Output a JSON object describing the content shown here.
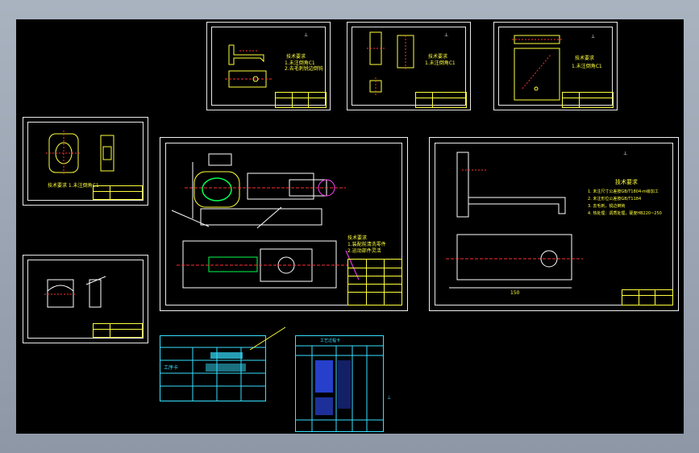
{
  "colors": {
    "background": "#000000",
    "frame": "#9aa4b2",
    "border": "#ffffff",
    "yellow": "#ffff3c",
    "cyan": "#36e0ff",
    "red": "#ff3030",
    "green": "#00ff50",
    "blue": "#3050ff",
    "magenta": "#ff40ff"
  },
  "sheets": {
    "top_left": {
      "title": ""
    },
    "main_assembly": {
      "notes_title": "技术要求"
    },
    "right_part": {
      "heading": "技术要求",
      "note1": "1. 未注尺寸公差按GB/T1804-m级加工",
      "note2": "2. 未注形位公差按GB/T1184",
      "note3": "3. 去毛刺，锐边倒钝",
      "note4": "4. 热处理：调质处理，硬度HB220~250",
      "dim_bottom": "150"
    },
    "process_card": {
      "label": "工序卡"
    },
    "process_table": {
      "label": "工艺过程卡"
    }
  }
}
